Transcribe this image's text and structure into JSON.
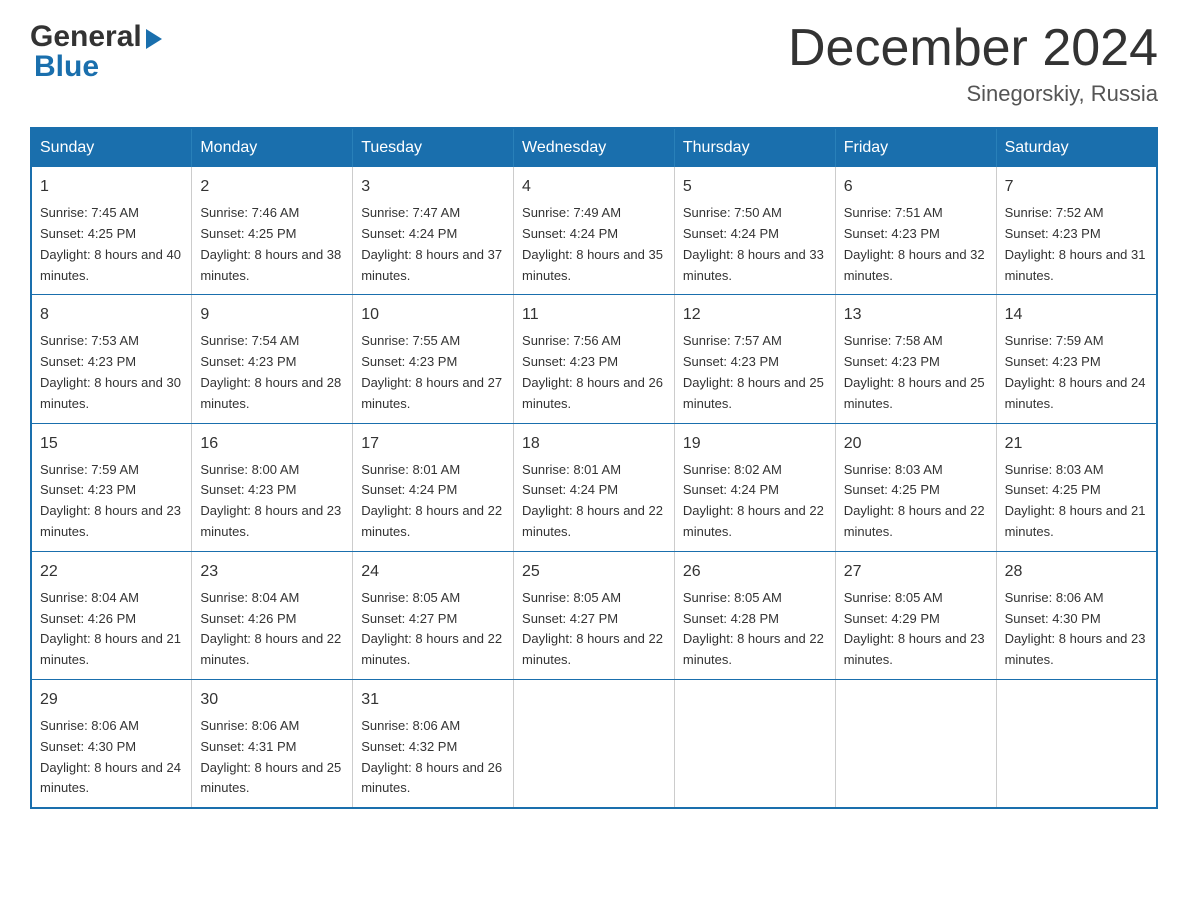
{
  "header": {
    "logo_general": "General",
    "logo_blue": "Blue",
    "month_title": "December 2024",
    "location": "Sinegorskiy, Russia"
  },
  "calendar": {
    "days_of_week": [
      "Sunday",
      "Monday",
      "Tuesday",
      "Wednesday",
      "Thursday",
      "Friday",
      "Saturday"
    ],
    "weeks": [
      [
        {
          "day": "1",
          "sunrise": "7:45 AM",
          "sunset": "4:25 PM",
          "daylight": "8 hours and 40 minutes."
        },
        {
          "day": "2",
          "sunrise": "7:46 AM",
          "sunset": "4:25 PM",
          "daylight": "8 hours and 38 minutes."
        },
        {
          "day": "3",
          "sunrise": "7:47 AM",
          "sunset": "4:24 PM",
          "daylight": "8 hours and 37 minutes."
        },
        {
          "day": "4",
          "sunrise": "7:49 AM",
          "sunset": "4:24 PM",
          "daylight": "8 hours and 35 minutes."
        },
        {
          "day": "5",
          "sunrise": "7:50 AM",
          "sunset": "4:24 PM",
          "daylight": "8 hours and 33 minutes."
        },
        {
          "day": "6",
          "sunrise": "7:51 AM",
          "sunset": "4:23 PM",
          "daylight": "8 hours and 32 minutes."
        },
        {
          "day": "7",
          "sunrise": "7:52 AM",
          "sunset": "4:23 PM",
          "daylight": "8 hours and 31 minutes."
        }
      ],
      [
        {
          "day": "8",
          "sunrise": "7:53 AM",
          "sunset": "4:23 PM",
          "daylight": "8 hours and 30 minutes."
        },
        {
          "day": "9",
          "sunrise": "7:54 AM",
          "sunset": "4:23 PM",
          "daylight": "8 hours and 28 minutes."
        },
        {
          "day": "10",
          "sunrise": "7:55 AM",
          "sunset": "4:23 PM",
          "daylight": "8 hours and 27 minutes."
        },
        {
          "day": "11",
          "sunrise": "7:56 AM",
          "sunset": "4:23 PM",
          "daylight": "8 hours and 26 minutes."
        },
        {
          "day": "12",
          "sunrise": "7:57 AM",
          "sunset": "4:23 PM",
          "daylight": "8 hours and 25 minutes."
        },
        {
          "day": "13",
          "sunrise": "7:58 AM",
          "sunset": "4:23 PM",
          "daylight": "8 hours and 25 minutes."
        },
        {
          "day": "14",
          "sunrise": "7:59 AM",
          "sunset": "4:23 PM",
          "daylight": "8 hours and 24 minutes."
        }
      ],
      [
        {
          "day": "15",
          "sunrise": "7:59 AM",
          "sunset": "4:23 PM",
          "daylight": "8 hours and 23 minutes."
        },
        {
          "day": "16",
          "sunrise": "8:00 AM",
          "sunset": "4:23 PM",
          "daylight": "8 hours and 23 minutes."
        },
        {
          "day": "17",
          "sunrise": "8:01 AM",
          "sunset": "4:24 PM",
          "daylight": "8 hours and 22 minutes."
        },
        {
          "day": "18",
          "sunrise": "8:01 AM",
          "sunset": "4:24 PM",
          "daylight": "8 hours and 22 minutes."
        },
        {
          "day": "19",
          "sunrise": "8:02 AM",
          "sunset": "4:24 PM",
          "daylight": "8 hours and 22 minutes."
        },
        {
          "day": "20",
          "sunrise": "8:03 AM",
          "sunset": "4:25 PM",
          "daylight": "8 hours and 22 minutes."
        },
        {
          "day": "21",
          "sunrise": "8:03 AM",
          "sunset": "4:25 PM",
          "daylight": "8 hours and 21 minutes."
        }
      ],
      [
        {
          "day": "22",
          "sunrise": "8:04 AM",
          "sunset": "4:26 PM",
          "daylight": "8 hours and 21 minutes."
        },
        {
          "day": "23",
          "sunrise": "8:04 AM",
          "sunset": "4:26 PM",
          "daylight": "8 hours and 22 minutes."
        },
        {
          "day": "24",
          "sunrise": "8:05 AM",
          "sunset": "4:27 PM",
          "daylight": "8 hours and 22 minutes."
        },
        {
          "day": "25",
          "sunrise": "8:05 AM",
          "sunset": "4:27 PM",
          "daylight": "8 hours and 22 minutes."
        },
        {
          "day": "26",
          "sunrise": "8:05 AM",
          "sunset": "4:28 PM",
          "daylight": "8 hours and 22 minutes."
        },
        {
          "day": "27",
          "sunrise": "8:05 AM",
          "sunset": "4:29 PM",
          "daylight": "8 hours and 23 minutes."
        },
        {
          "day": "28",
          "sunrise": "8:06 AM",
          "sunset": "4:30 PM",
          "daylight": "8 hours and 23 minutes."
        }
      ],
      [
        {
          "day": "29",
          "sunrise": "8:06 AM",
          "sunset": "4:30 PM",
          "daylight": "8 hours and 24 minutes."
        },
        {
          "day": "30",
          "sunrise": "8:06 AM",
          "sunset": "4:31 PM",
          "daylight": "8 hours and 25 minutes."
        },
        {
          "day": "31",
          "sunrise": "8:06 AM",
          "sunset": "4:32 PM",
          "daylight": "8 hours and 26 minutes."
        },
        null,
        null,
        null,
        null
      ]
    ]
  }
}
